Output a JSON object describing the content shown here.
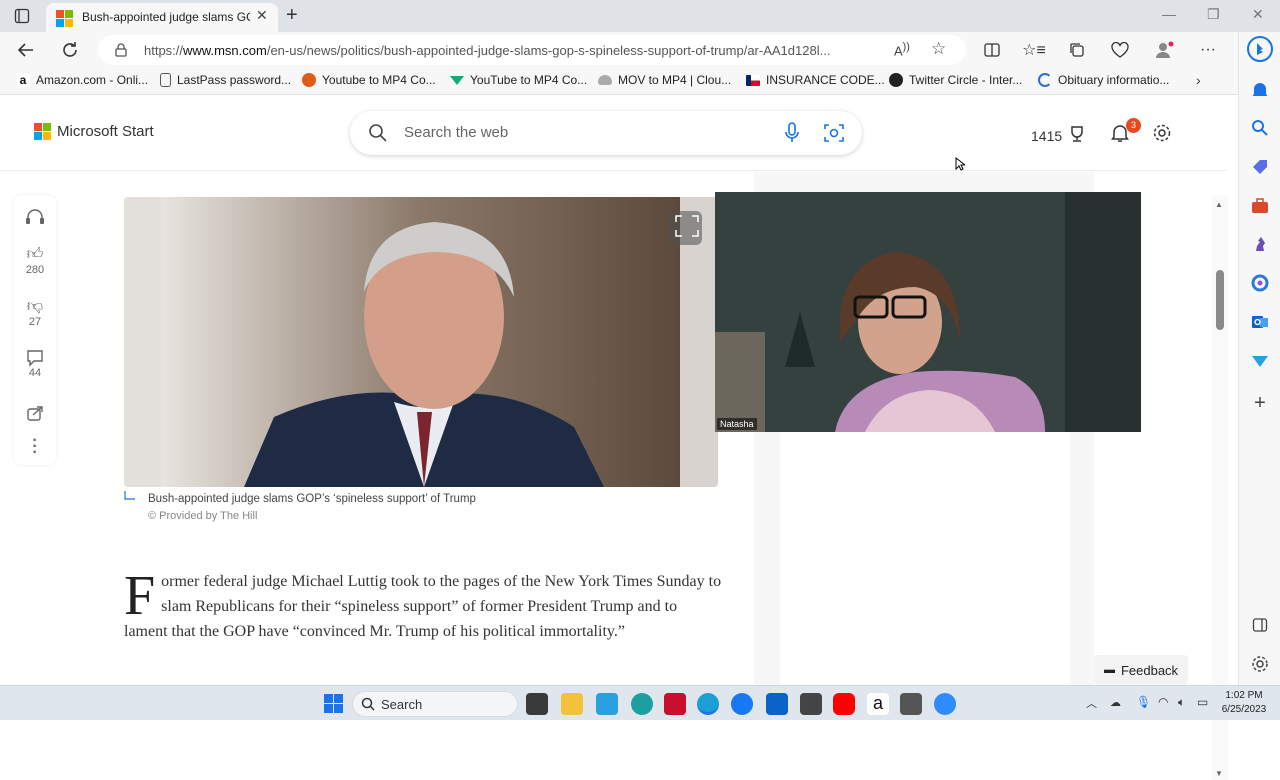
{
  "browser": {
    "tab_title": "Bush-appointed judge slams GO",
    "url_prefix": "https://",
    "url_host": "www.msn.com",
    "url_path": "/en-us/news/politics/bush-appointed-judge-slams-gop-s-spineless-support-of-trump/ar-AA1d128l...",
    "favorites": [
      {
        "label": "Amazon.com - Onli...",
        "icon": "amazon-icon",
        "color": "#ff9900"
      },
      {
        "label": "LastPass password...",
        "icon": "document-icon",
        "color": "#777777"
      },
      {
        "label": "Youtube to MP4 Co...",
        "icon": "play-icon",
        "color": "#e05a1a"
      },
      {
        "label": "YouTube to MP4 Co...",
        "icon": "download-icon",
        "color": "#19a974"
      },
      {
        "label": "MOV to MP4 | Clou...",
        "icon": "cloud-icon",
        "color": "#888888"
      },
      {
        "label": "INSURANCE CODE...",
        "icon": "texas-flag-icon",
        "color": "#c8102e"
      },
      {
        "label": "Twitter Circle - Inter...",
        "icon": "circle-icon",
        "color": "#222222"
      },
      {
        "label": "Obituary informatio...",
        "icon": "c-icon",
        "color": "#2d6fc8"
      }
    ]
  },
  "msn": {
    "brand": "Microsoft Start",
    "search_placeholder": "Search the web",
    "rewards_points": "1415",
    "notification_count": "3"
  },
  "rail": {
    "likes": "280",
    "dislikes": "27",
    "comments": "44"
  },
  "article": {
    "image_caption": "Bush-appointed judge slams GOP’s ‘spineless support’ of Trump",
    "image_credit": "© Provided by The Hill",
    "dropcap": "F",
    "body": "ormer federal judge Michael Luttig took to the pages of the New York Times Sunday to slam Republicans for their “spineless support” of former President Trump and to lament that the GOP have “convinced Mr. Trump of his political immortality.”"
  },
  "video": {
    "participant_name": "Natasha"
  },
  "feedback_label": "Feedback",
  "taskbar": {
    "search_label": "Search",
    "time": "1:02 PM",
    "date": "6/25/2023"
  }
}
